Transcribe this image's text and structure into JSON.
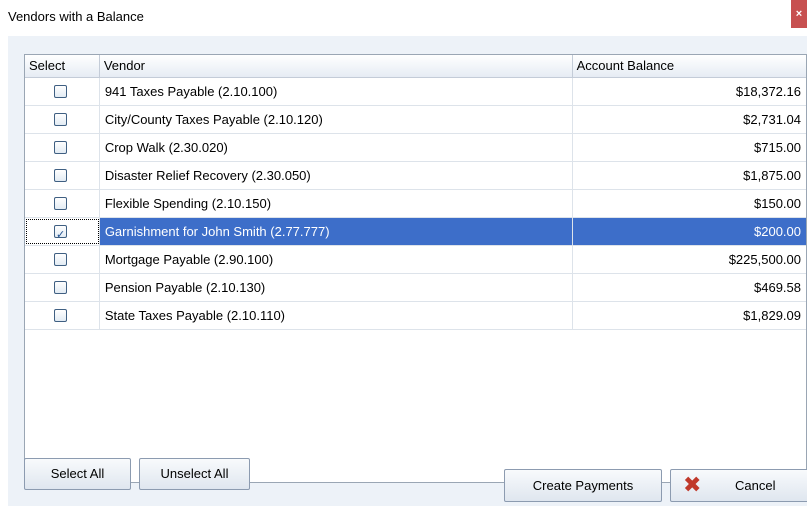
{
  "window": {
    "title": "Vendors with a Balance",
    "close_glyph": "×"
  },
  "grid": {
    "columns": [
      "Select",
      "Vendor",
      "Account Balance"
    ],
    "rows": [
      {
        "vendor": "941 Taxes Payable (2.10.100)",
        "balance": "$18,372.16",
        "checked": false,
        "selected": false
      },
      {
        "vendor": "City/County Taxes Payable (2.10.120)",
        "balance": "$2,731.04",
        "checked": false,
        "selected": false
      },
      {
        "vendor": "Crop Walk (2.30.020)",
        "balance": "$715.00",
        "checked": false,
        "selected": false
      },
      {
        "vendor": "Disaster Relief Recovery (2.30.050)",
        "balance": "$1,875.00",
        "checked": false,
        "selected": false
      },
      {
        "vendor": "Flexible Spending (2.10.150)",
        "balance": "$150.00",
        "checked": false,
        "selected": false
      },
      {
        "vendor": "Garnishment for John Smith (2.77.777)",
        "balance": "$200.00",
        "checked": true,
        "selected": true
      },
      {
        "vendor": "Mortgage Payable (2.90.100)",
        "balance": "$225,500.00",
        "checked": false,
        "selected": false
      },
      {
        "vendor": "Pension Payable (2.10.130)",
        "balance": "$469.58",
        "checked": false,
        "selected": false
      },
      {
        "vendor": "State Taxes Payable (2.10.110)",
        "balance": "$1,829.09",
        "checked": false,
        "selected": false
      }
    ]
  },
  "buttons": {
    "select_all": "Select All",
    "unselect_all": "Unselect All",
    "create_payments": "Create Payments",
    "cancel": "Cancel"
  },
  "icons": {
    "checkmark": "✓",
    "cancel": "✖"
  },
  "colors": {
    "selection": "#3d6ec9",
    "cancel_icon": "#c0392b",
    "client_background": "#edf2f8"
  }
}
